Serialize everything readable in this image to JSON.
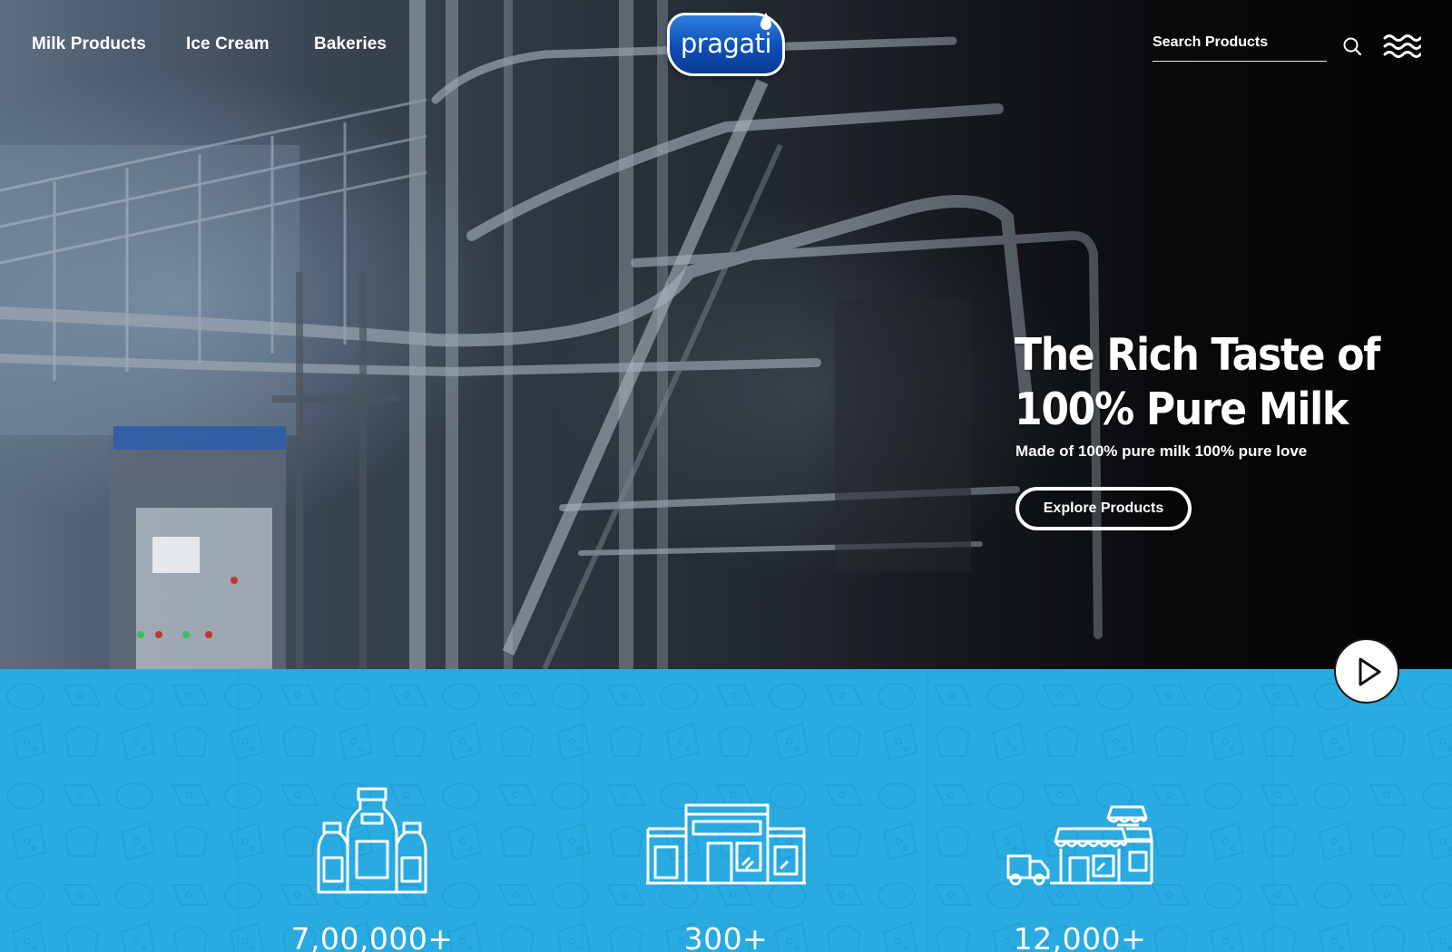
{
  "nav": {
    "links": [
      "Milk Products",
      "Ice Cream",
      "Bakeries"
    ],
    "logo_text": "pragati",
    "search_placeholder": "Search Products"
  },
  "hero": {
    "headline_line1": "The Rich Taste of",
    "headline_line2": "100% Pure Milk",
    "subheading": "Made of 100% pure milk 100% pure love",
    "cta_label": "Explore Products"
  },
  "stats": [
    {
      "icon": "milk-bottles-icon",
      "value": "7,00,000+"
    },
    {
      "icon": "store-building-icon",
      "value": "300+"
    },
    {
      "icon": "retail-outlet-delivery-icon",
      "value": "12,000+"
    }
  ],
  "colors": {
    "stats_background": "#29abe2",
    "logo_blue": "#0e4fb6",
    "text_white": "#ffffff"
  }
}
